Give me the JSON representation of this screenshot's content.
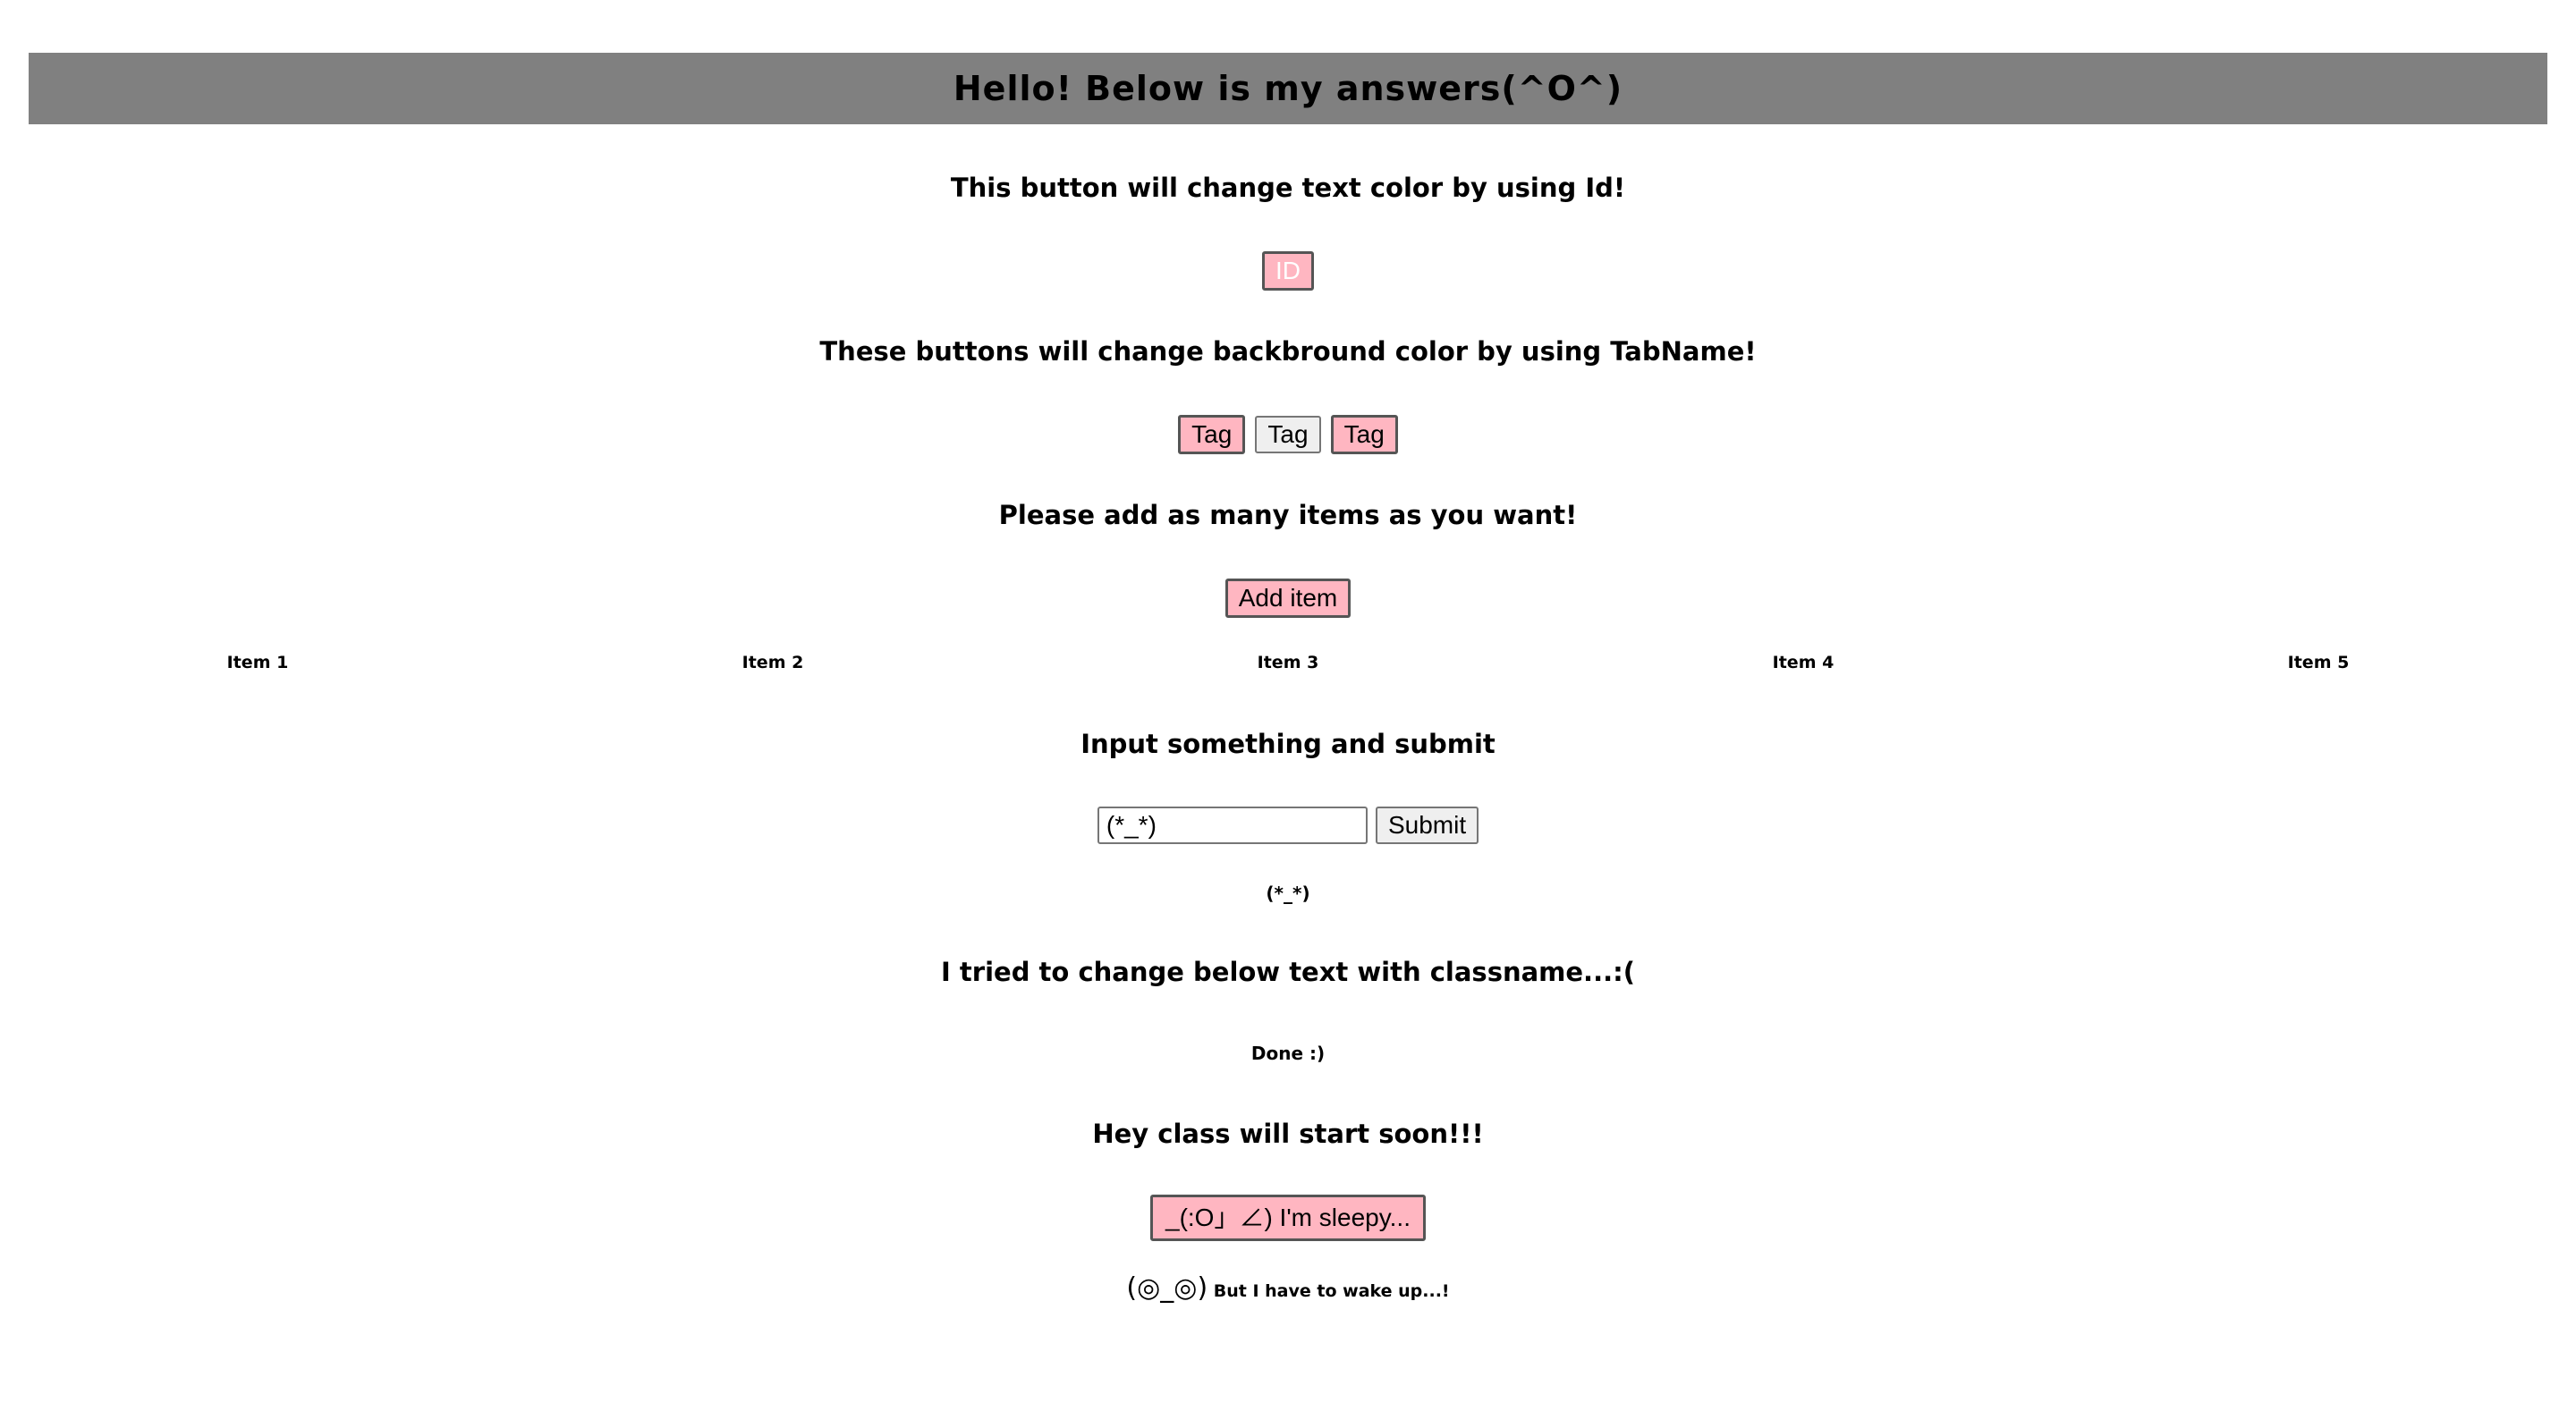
{
  "header": {
    "title": "Hello! Below is my answers(^O^)"
  },
  "id_section": {
    "heading": "This button will change text color by using Id!",
    "button_label": "ID"
  },
  "tag_section": {
    "heading": "These buttons will change backbround color by using TabName!",
    "buttons": [
      "Tag",
      "Tag",
      "Tag"
    ]
  },
  "items_section": {
    "heading": "Please add as many items as you want!",
    "button_label": "Add item",
    "items": [
      "Item 1",
      "Item 2",
      "Item 3",
      "Item 4",
      "Item 5"
    ]
  },
  "input_section": {
    "heading": "Input something and submit",
    "input_value": "(*_*)",
    "submit_label": "Submit",
    "output": "(*_*)"
  },
  "classname_section": {
    "heading": "I tried to change below text with classname...:(",
    "result": "Done :)"
  },
  "class_section": {
    "heading": "Hey class will start soon!!!",
    "button_label": "_(:O」∠) I'm sleepy...",
    "face": "(◎_◎)",
    "message": " But I have to wake up...!"
  },
  "colors": {
    "banner": "#808080",
    "pink_button": "#ffb6c1",
    "id_button_text": "#ffffff"
  }
}
